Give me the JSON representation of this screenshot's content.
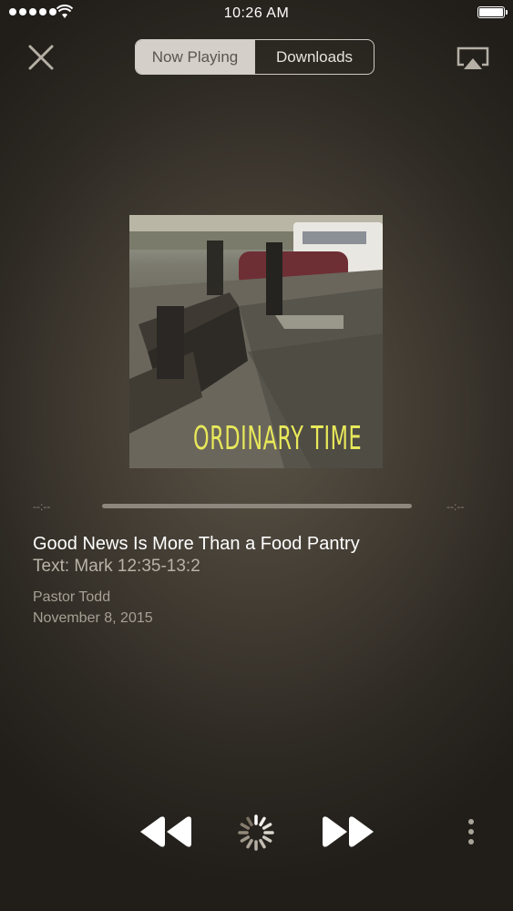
{
  "status_bar": {
    "time": "10:26 AM",
    "icons": [
      "signal-dots-icon",
      "wifi-icon",
      "battery-icon"
    ]
  },
  "nav": {
    "close_icon": "close-icon",
    "tabs": [
      {
        "label": "Now Playing",
        "active": true
      },
      {
        "label": "Downloads",
        "active": false
      }
    ],
    "airplay_icon": "airplay-icon"
  },
  "artwork": {
    "title_text": "ORDINARY TIME"
  },
  "progress": {
    "elapsed": "--:--",
    "remaining": "--:--"
  },
  "track": {
    "title": "Good News Is More Than a Food Pantry",
    "subtitle": "Text: Mark 12:35-13:2",
    "speaker": "Pastor Todd",
    "date": "November 8, 2015"
  },
  "controls": {
    "icons": [
      "rewind-icon",
      "loading-spinner-icon",
      "fast-forward-icon",
      "more-vertical-icon"
    ]
  },
  "colors": {
    "segment_active_bg": "#d4d0c9",
    "segment_active_text": "#5a554d",
    "artwork_text": "#e8e85a",
    "secondary_text": "#a7a094"
  }
}
